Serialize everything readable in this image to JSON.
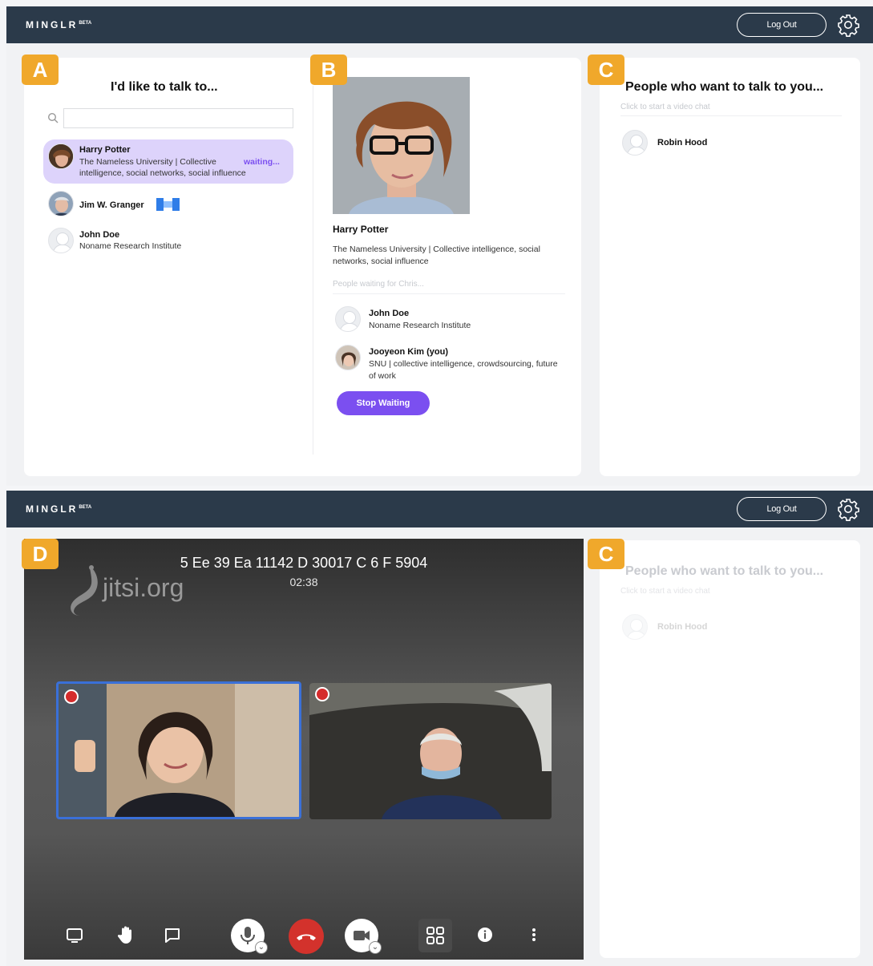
{
  "app": {
    "logo": "MINGLR",
    "logo_sup": "BETA",
    "logout_label": "Log Out"
  },
  "badges": {
    "a": "A",
    "b": "B",
    "c": "C",
    "d": "D"
  },
  "panel_a": {
    "title": "I'd like to talk to...",
    "search_value": "",
    "items": [
      {
        "name": "Harry Potter",
        "line1": "The Nameless University | Collective",
        "line2": "intelligence, social networks, social influence",
        "status": "waiting..."
      },
      {
        "name": "Jim W. Granger"
      },
      {
        "name": "John Doe",
        "line1": "Noname Research Institute"
      }
    ]
  },
  "panel_b": {
    "name": "Harry Potter",
    "desc": "The Nameless University | Collective intelligence, social networks, social influence",
    "waiting_label": "People waiting for Chris...",
    "waiting": [
      {
        "name": "John Doe",
        "desc": "Noname Research Institute"
      },
      {
        "name": "Jooyeon Kim  (you)",
        "desc": "SNU | collective intelligence, crowdsourcing, future of work"
      }
    ],
    "stop_label": "Stop Waiting"
  },
  "panel_c": {
    "title": "People who want to talk to you...",
    "hint": "Click to start a video chat",
    "items": [
      {
        "name": "Robin Hood"
      }
    ]
  },
  "video": {
    "room": "5 Ee 39 Ea 11142 D 30017 C 6 F 5904",
    "timer": "02:38",
    "watermark": "jitsi.org"
  },
  "colors": {
    "topbar": "#2b3a4a",
    "accent": "#7b4ff0",
    "badge": "#f0a82b",
    "hangup": "#d3322c"
  }
}
